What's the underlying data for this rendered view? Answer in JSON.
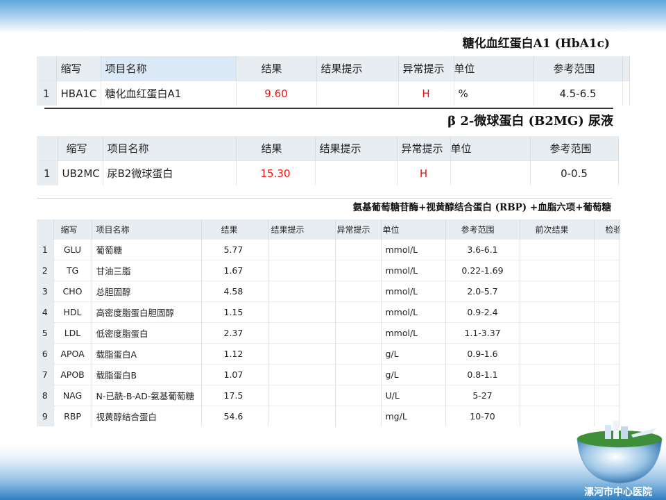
{
  "sections": [
    {
      "title": "糖化血红蛋白A1 (HbA1c)",
      "headers": [
        "缩写",
        "项目名称",
        "结果",
        "结果提示",
        "异常提示",
        "单位",
        "参考范围"
      ],
      "rows": [
        {
          "n": "1",
          "code": "HBA1C",
          "name": "糖化血红蛋白A1",
          "result": "9.60",
          "hint": "",
          "flag": "H",
          "unit": "%",
          "ref": "4.5-6.5"
        }
      ]
    },
    {
      "title": "β 2-微球蛋白 (B2MG) 尿液",
      "headers": [
        "缩写",
        "项目名称",
        "结果",
        "结果提示",
        "异常提示",
        "单位",
        "参考范围"
      ],
      "rows": [
        {
          "n": "1",
          "code": "UB2MC",
          "name": "尿B2微球蛋白",
          "result": "15.30",
          "hint": "",
          "flag": "H",
          "unit": "",
          "ref": "0-0.5"
        }
      ]
    },
    {
      "title": "氨基葡萄糖苷酶+视黄醇结合蛋白 (RBP) +血脂六项+葡萄糖",
      "headers": [
        "缩写",
        "项目名称",
        "结果",
        "结果提示",
        "异常提示",
        "单位",
        "参考范围",
        "前次结果",
        "检验"
      ],
      "rows": [
        {
          "n": "1",
          "code": "GLU",
          "name": "葡萄糖",
          "result": "5.77",
          "unit": "mmol/L",
          "ref": "3.6-6.1"
        },
        {
          "n": "2",
          "code": "TG",
          "name": "甘油三脂",
          "result": "1.67",
          "unit": "mmol/L",
          "ref": "0.22-1.69"
        },
        {
          "n": "3",
          "code": "CHO",
          "name": "总胆固醇",
          "result": "4.58",
          "unit": "mmol/L",
          "ref": "2.0-5.7"
        },
        {
          "n": "4",
          "code": "HDL",
          "name": "高密度脂蛋白胆固醇",
          "result": "1.15",
          "unit": "mmol/L",
          "ref": "0.9-2.4"
        },
        {
          "n": "5",
          "code": "LDL",
          "name": "低密度脂蛋白",
          "result": "2.37",
          "unit": "mmol/L",
          "ref": "1.1-3.37"
        },
        {
          "n": "6",
          "code": "APOA",
          "name": "载脂蛋白A",
          "result": "1.12",
          "unit": "g/L",
          "ref": "0.9-1.6"
        },
        {
          "n": "7",
          "code": "APOB",
          "name": "载脂蛋白B",
          "result": "1.07",
          "unit": "g/L",
          "ref": "0.8-1.1"
        },
        {
          "n": "8",
          "code": "NAG",
          "name": "N-已酰-B-AD-氨基葡萄糖",
          "result": "17.5",
          "unit": "U/L",
          "ref": "5-27"
        },
        {
          "n": "9",
          "code": "RBP",
          "name": "视黄醇结合蛋白",
          "result": "54.6",
          "unit": "mg/L",
          "ref": "10-70"
        }
      ]
    }
  ],
  "hospital": "漯河市中心医院",
  "colors": {
    "flag": "#ee1111",
    "header": "#e8edf2",
    "accent": "#2f7fc1"
  }
}
